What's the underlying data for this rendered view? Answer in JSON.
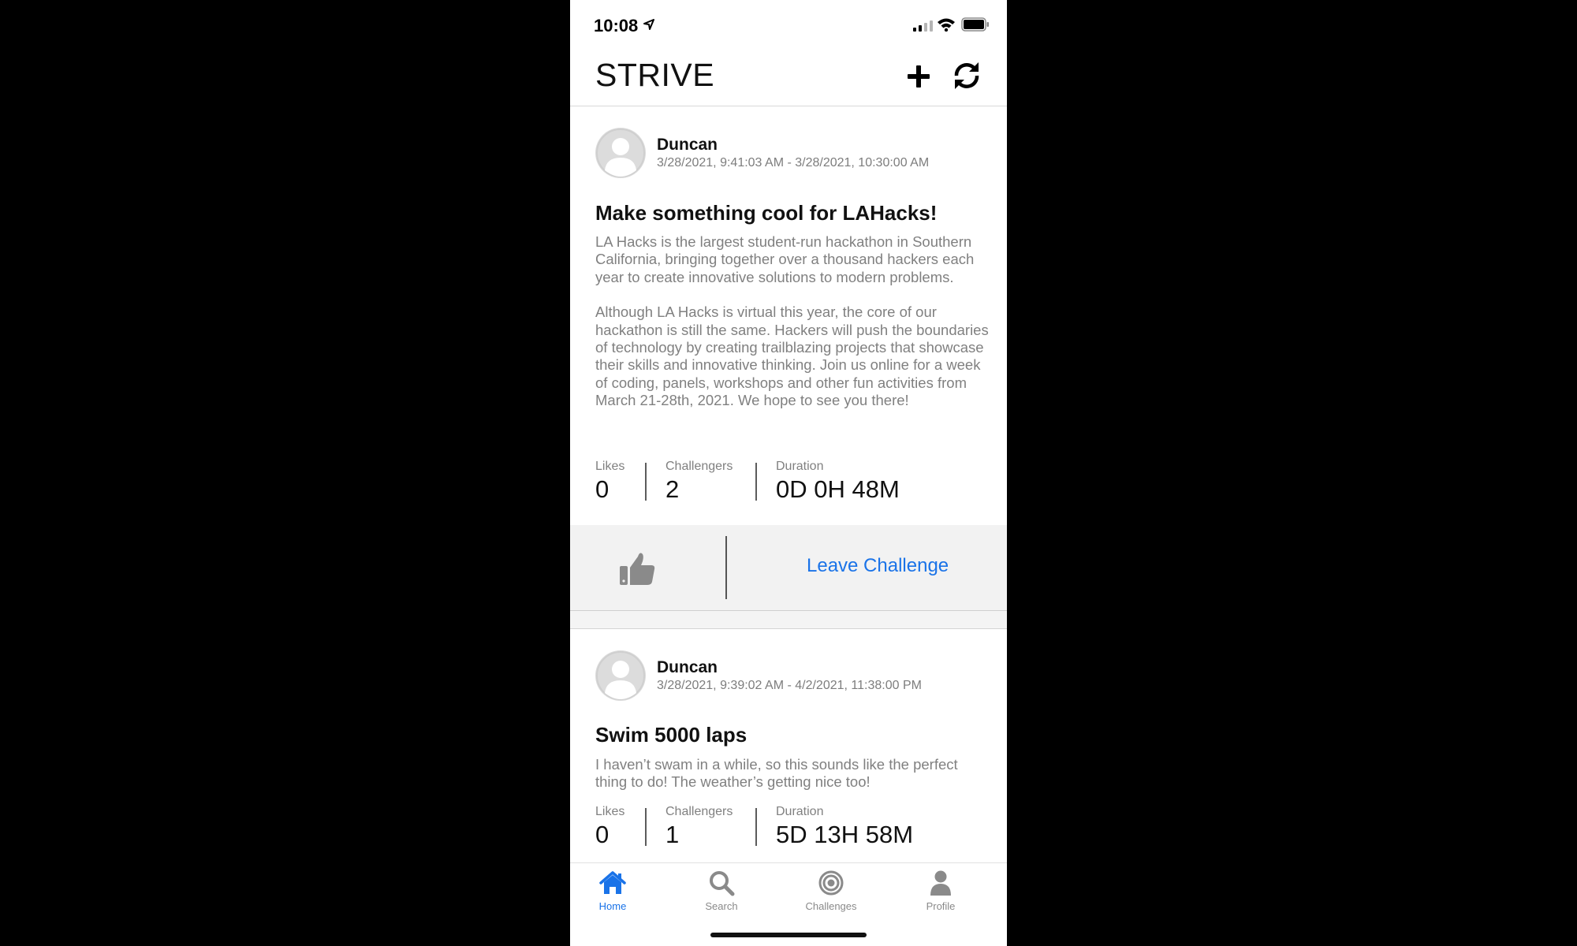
{
  "status_bar": {
    "time": "10:08"
  },
  "nav": {
    "title": "STRIVE"
  },
  "feed": {
    "cards": [
      {
        "author": "Duncan",
        "dates": "3/28/2021, 9:41:03 AM - 3/28/2021, 10:30:00 AM",
        "title": "Make something cool for LAHacks!",
        "paragraphs": [
          "LA Hacks is the largest student-run hackathon in Southern California, bringing together over a thousand hackers each year to create innovative solutions to modern problems.",
          "Although LA Hacks is virtual this year, the core of our hackathon is still the same. Hackers will push the boundaries of technology by creating trailblazing projects that showcase their skills and innovative thinking. Join us online for a week of coding, panels, workshops and other fun activities from March 21-28th, 2021. We hope to see you there!"
        ],
        "stats": {
          "likes_label": "Likes",
          "likes": "0",
          "challengers_label": "Challengers",
          "challengers": "2",
          "duration_label": "Duration",
          "duration": "0D 0H 48M"
        },
        "action": "Leave Challenge"
      },
      {
        "author": "Duncan",
        "dates": "3/28/2021, 9:39:02 AM - 4/2/2021, 11:38:00 PM",
        "title": "Swim 5000 laps",
        "paragraphs": [
          "I haven’t swam in a while, so this sounds like the perfect thing to do! The weather’s getting nice too!"
        ],
        "stats": {
          "likes_label": "Likes",
          "likes": "0",
          "challengers_label": "Challengers",
          "challengers": "1",
          "duration_label": "Duration",
          "duration": "5D 13H 58M"
        }
      }
    ]
  },
  "tabbar": {
    "items": [
      {
        "label": "Home",
        "icon": "home-icon",
        "active": true
      },
      {
        "label": "Search",
        "icon": "search-icon",
        "active": false
      },
      {
        "label": "Challenges",
        "icon": "target-icon",
        "active": false
      },
      {
        "label": "Profile",
        "icon": "person-icon",
        "active": false
      }
    ]
  },
  "colors": {
    "accent": "#1a73e8",
    "icon_gray": "#8a8a8a",
    "action_bar": "#f2f2f2"
  }
}
